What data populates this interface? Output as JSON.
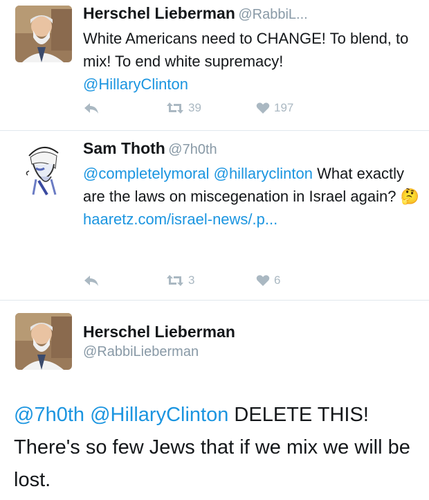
{
  "tweets": [
    {
      "name": "Herschel Lieberman",
      "handle": "@RabbiL...",
      "text_plain": "White Americans need to CHANGE! To blend, to mix! To end white supremacy!",
      "mention": "@HillaryClinton",
      "retweets": "39",
      "likes": "197"
    },
    {
      "name": "Sam Thoth",
      "handle": "@7h0th",
      "mentions": "@completelymoral @hillaryclinton",
      "text_plain": "What exactly are the laws on miscegenation in Israel again?",
      "emoji": "🤔",
      "link": "haaretz.com/israel-news/.p...",
      "retweets": "3",
      "likes": "6"
    },
    {
      "name": "Herschel Lieberman",
      "handle": "@RabbiLieberman",
      "mention1": "@7h0th",
      "mention2": "@HillaryClinton",
      "text_plain": "DELETE THIS! There's so few Jews that if we mix we will be lost."
    }
  ],
  "icons": {
    "reply": "reply-icon",
    "retweet": "retweet-icon",
    "like": "heart-icon"
  },
  "colors": {
    "link": "#1b95e0",
    "meta": "#8899a6",
    "action": "#aab8c2"
  }
}
